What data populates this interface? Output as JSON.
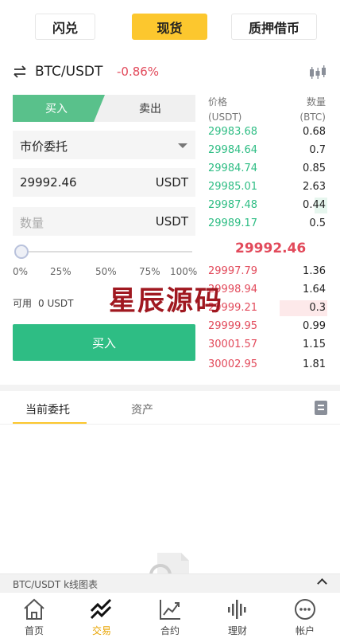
{
  "mode_tabs": [
    {
      "label": "闪兑",
      "active": false
    },
    {
      "label": "现货",
      "active": true
    },
    {
      "label": "质押借币",
      "active": false
    }
  ],
  "pair": {
    "name": "BTC/USDT",
    "change": "-0.86%"
  },
  "trade": {
    "buy_tab": "买入",
    "sell_tab": "卖出",
    "order_type": "市价委托",
    "price_value": "29992.46",
    "price_unit": "USDT",
    "amount_placeholder": "数量",
    "amount_unit": "USDT",
    "slider_level": 0,
    "percents": [
      "0%",
      "25%",
      "50%",
      "75%",
      "100%"
    ],
    "available_label": "可用",
    "available_value": "0 USDT",
    "buy_button": "买入"
  },
  "orderbook": {
    "price_header": "价格",
    "price_unit": "(USDT)",
    "qty_header": "数量",
    "qty_unit": "(BTC)",
    "bids": [
      {
        "price": "29983.68",
        "qty": "0.68"
      },
      {
        "price": "29984.64",
        "qty": "0.7"
      },
      {
        "price": "29984.74",
        "qty": "0.85"
      },
      {
        "price": "29985.01",
        "qty": "2.63"
      },
      {
        "price": "29987.48",
        "qty": "0.44"
      },
      {
        "price": "29989.17",
        "qty": "0.5"
      }
    ],
    "mid_price": "29992.46",
    "asks": [
      {
        "price": "29997.79",
        "qty": "1.36"
      },
      {
        "price": "29998.94",
        "qty": "1.64"
      },
      {
        "price": "29999.21",
        "qty": "0.3"
      },
      {
        "price": "29999.95",
        "qty": "0.99"
      },
      {
        "price": "30001.57",
        "qty": "1.15"
      },
      {
        "price": "30002.95",
        "qty": "1.81"
      }
    ]
  },
  "watermark": "星辰源码",
  "sub_tabs": {
    "current_orders": "当前委托",
    "assets": "资产"
  },
  "kline_bar": {
    "label": "BTC/USDT k线图表"
  },
  "bottom_nav": [
    {
      "label": "首页",
      "icon": "home-icon",
      "active": false
    },
    {
      "label": "交易",
      "icon": "trade-icon",
      "active": true
    },
    {
      "label": "合约",
      "icon": "contract-chart-icon",
      "active": false
    },
    {
      "label": "理财",
      "icon": "finance-wave-icon",
      "active": false
    },
    {
      "label": "帐户",
      "icon": "account-icon",
      "active": false
    }
  ],
  "colors": {
    "accent": "#fcc72e",
    "buy": "#2ebd84",
    "sell": "#e24a5b"
  }
}
